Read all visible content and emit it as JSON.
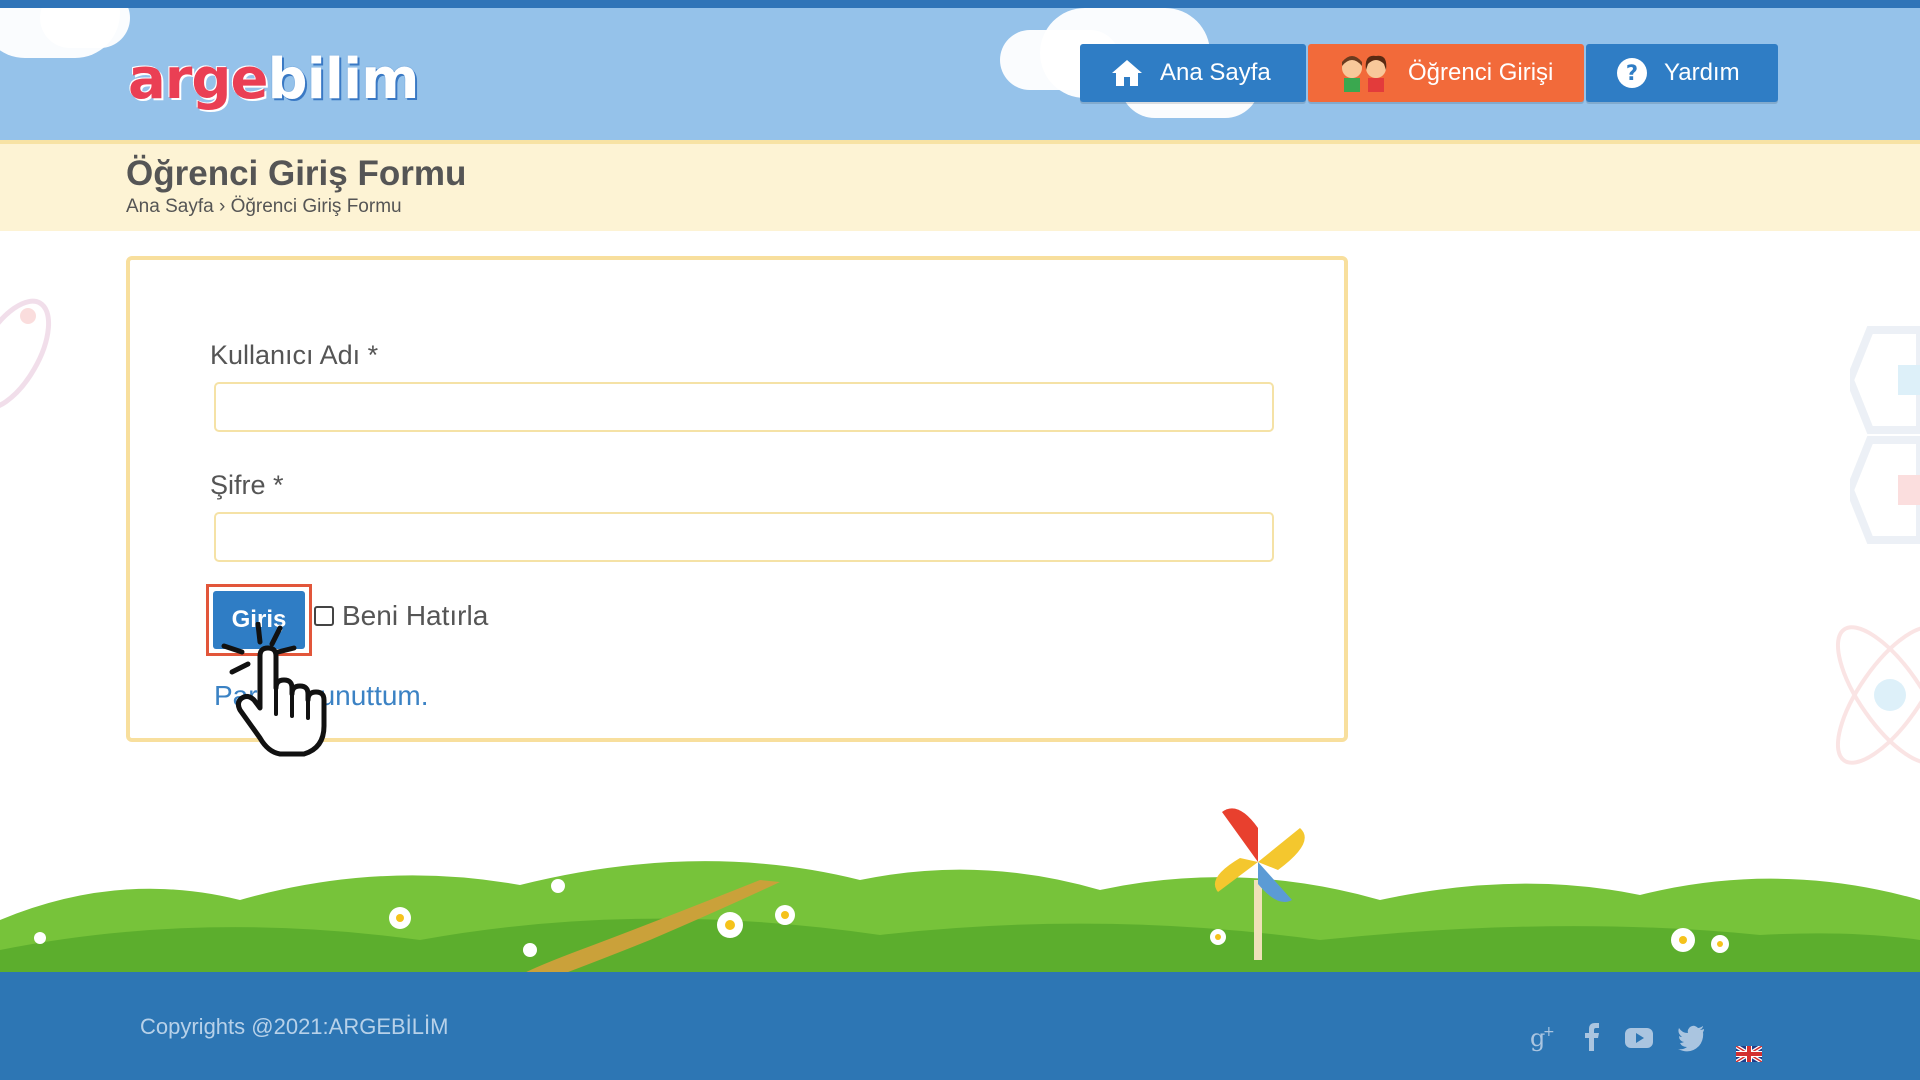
{
  "brand": {
    "logo_part1": "arge",
    "logo_part2": "bilim"
  },
  "nav": {
    "home_label": "Ana Sayfa",
    "student_login_label": "Öğrenci Girişi",
    "help_label": "Yardım"
  },
  "page": {
    "title": "Öğrenci Giriş Formu",
    "breadcrumb_home": "Ana Sayfa",
    "breadcrumb_sep": "›",
    "breadcrumb_current": "Öğrenci Giriş Formu"
  },
  "form": {
    "username_label": "Kullanıcı Adı *",
    "username_value": "",
    "password_label": "Şifre *",
    "password_value": "",
    "login_button": "Giriş",
    "remember_label": "Beni Hatırla",
    "remember_checked": false,
    "forgot_visible_left": "Par",
    "forgot_visible_right": "unuttum."
  },
  "footer": {
    "copyright": "Copyrights @2021:ARGEBİLİM",
    "social_icons": [
      "google-plus-icon",
      "facebook-icon",
      "youtube-icon",
      "twitter-icon",
      "uk-flag-icon"
    ]
  },
  "colors": {
    "header_bg": "#95c2ea",
    "nav_blue": "#2f7dc5",
    "nav_orange": "#f26a3a",
    "title_bar_bg": "#fdf3d4",
    "form_border": "#f8df9d",
    "footer_bg": "#2d76b4",
    "link": "#3b82c4"
  }
}
